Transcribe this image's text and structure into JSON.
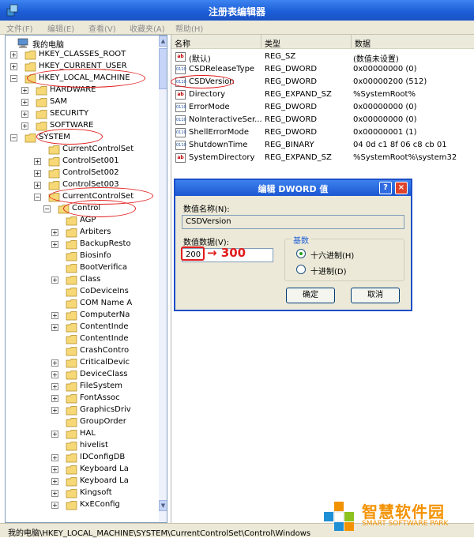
{
  "window": {
    "title": "注册表编辑器"
  },
  "menu": [
    "文件(F)",
    "编辑(E)",
    "查看(V)",
    "收藏夹(A)",
    "帮助(H)"
  ],
  "tree": {
    "root": "我的电脑",
    "nodes": [
      {
        "label": "HKEY_CLASSES_ROOT",
        "expander": "+"
      },
      {
        "label": "HKEY_CURRENT_USER",
        "expander": "+"
      },
      {
        "label": "HKEY_LOCAL_MACHINE",
        "expander": "−"
      },
      {
        "label": "HARDWARE",
        "expander": "+"
      },
      {
        "label": "SAM",
        "expander": "+"
      },
      {
        "label": "SECURITY",
        "expander": "+"
      },
      {
        "label": "SOFTWARE",
        "expander": "+"
      },
      {
        "label": "SYSTEM",
        "expander": "−"
      },
      {
        "label": "CurrentControlSet",
        "expander": ""
      },
      {
        "label": "ControlSet001",
        "expander": "+"
      },
      {
        "label": "ControlSet002",
        "expander": "+"
      },
      {
        "label": "ControlSet003",
        "expander": "+"
      },
      {
        "label": "CurrentControlSet",
        "expander": "−"
      },
      {
        "label": "Control",
        "expander": "−"
      },
      {
        "label": "AGP",
        "expander": ""
      },
      {
        "label": "Arbiters",
        "expander": "+"
      },
      {
        "label": "BackupResto",
        "expander": "+"
      },
      {
        "label": "Biosinfo",
        "expander": ""
      },
      {
        "label": "BootVerifica",
        "expander": ""
      },
      {
        "label": "Class",
        "expander": "+"
      },
      {
        "label": "CoDeviceIns",
        "expander": ""
      },
      {
        "label": "COM Name A",
        "expander": ""
      },
      {
        "label": "ComputerNa",
        "expander": "+"
      },
      {
        "label": "ContentInde",
        "expander": "+"
      },
      {
        "label": "ContentInde",
        "expander": ""
      },
      {
        "label": "CrashContro",
        "expander": ""
      },
      {
        "label": "CriticalDevic",
        "expander": "+"
      },
      {
        "label": "DeviceClass",
        "expander": "+"
      },
      {
        "label": "FileSystem",
        "expander": "+"
      },
      {
        "label": "FontAssoc",
        "expander": "+"
      },
      {
        "label": "GraphicsDriv",
        "expander": "+"
      },
      {
        "label": "GroupOrder",
        "expander": ""
      },
      {
        "label": "HAL",
        "expander": "+"
      },
      {
        "label": "hivelist",
        "expander": ""
      },
      {
        "label": "IDConfigDB",
        "expander": "+"
      },
      {
        "label": "Keyboard La",
        "expander": "+"
      },
      {
        "label": "Keyboard La",
        "expander": "+"
      },
      {
        "label": "Kingsoft",
        "expander": "+"
      },
      {
        "label": "KxEConfig",
        "expander": "+"
      }
    ]
  },
  "list": {
    "headers": {
      "name": "名称",
      "type": "类型",
      "data": "数据"
    },
    "rows": [
      {
        "name": "(默认)",
        "type": "REG_SZ",
        "data": "(数值未设置)",
        "icon": "ab"
      },
      {
        "name": "CSDReleaseType",
        "type": "REG_DWORD",
        "data": "0x00000000 (0)",
        "icon": "bin"
      },
      {
        "name": "CSDVersion",
        "type": "REG_DWORD",
        "data": "0x00000200 (512)",
        "icon": "bin"
      },
      {
        "name": "Directory",
        "type": "REG_EXPAND_SZ",
        "data": "%SystemRoot%",
        "icon": "ab"
      },
      {
        "name": "ErrorMode",
        "type": "REG_DWORD",
        "data": "0x00000000 (0)",
        "icon": "bin"
      },
      {
        "name": "NoInteractiveSer...",
        "type": "REG_DWORD",
        "data": "0x00000000 (0)",
        "icon": "bin"
      },
      {
        "name": "ShellErrorMode",
        "type": "REG_DWORD",
        "data": "0x00000001 (1)",
        "icon": "bin"
      },
      {
        "name": "ShutdownTime",
        "type": "REG_BINARY",
        "data": "04 0d c1 8f 06 c8 cb 01",
        "icon": "bin"
      },
      {
        "name": "SystemDirectory",
        "type": "REG_EXPAND_SZ",
        "data": "%SystemRoot%\\system32",
        "icon": "ab"
      }
    ]
  },
  "dialog": {
    "title": "编辑 DWORD 值",
    "help_btn": "?",
    "close_btn": "×",
    "name_label": "数值名称(N):",
    "name_value": "CSDVersion",
    "data_label": "数值数据(V):",
    "data_value": "200",
    "annotation": "→ 300",
    "base_title": "基数",
    "radio_hex": "十六进制(H)",
    "radio_dec": "十进制(D)",
    "ok": "确定",
    "cancel": "取消"
  },
  "status": "我的电脑\\HKEY_LOCAL_MACHINE\\SYSTEM\\CurrentControlSet\\Control\\Windows",
  "watermark": {
    "name": "智慧软件园",
    "sub": "SMART SOFTWARE PARK"
  },
  "colors": {
    "titlebar": "#1d5fd8",
    "annotation": "#e11d1d",
    "logo": "#f39200"
  }
}
